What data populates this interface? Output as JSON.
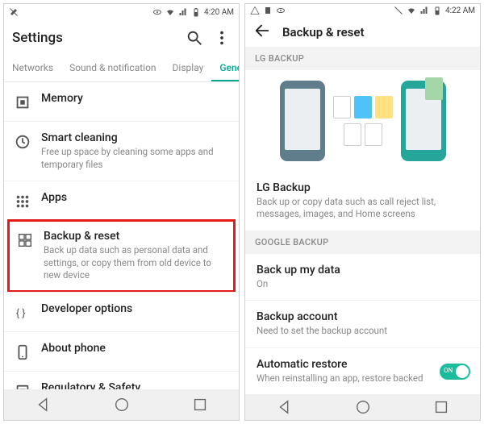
{
  "left": {
    "status": {
      "time": "4:20 AM"
    },
    "header": {
      "title": "Settings"
    },
    "tabs": [
      {
        "label": "Networks",
        "active": false
      },
      {
        "label": "Sound & notification",
        "active": false
      },
      {
        "label": "Display",
        "active": false
      },
      {
        "label": "General",
        "active": true
      }
    ],
    "items": [
      {
        "icon": "memory",
        "title": "Memory",
        "sub": ""
      },
      {
        "icon": "smart-cleaning",
        "title": "Smart cleaning",
        "sub": "Free up space by cleaning some apps and temporary files"
      },
      {
        "icon": "apps",
        "title": "Apps",
        "sub": ""
      },
      {
        "icon": "backup-reset",
        "title": "Backup & reset",
        "sub": "Back up data such as personal data and settings, or copy them from old device to new device",
        "highlight": true
      },
      {
        "icon": "developer",
        "title": "Developer options",
        "sub": ""
      },
      {
        "icon": "about-phone",
        "title": "About phone",
        "sub": ""
      },
      {
        "icon": "regulatory",
        "title": "Regulatory & Safety",
        "sub": ""
      }
    ]
  },
  "right": {
    "status": {
      "time": "4:22 AM"
    },
    "header": {
      "title": "Backup & reset"
    },
    "sections": {
      "lg": {
        "header": "LG BACKUP",
        "item": {
          "title": "LG Backup",
          "sub": "Back up or copy data such as call reject list, messages, images, and Home screens"
        }
      },
      "google": {
        "header": "GOOGLE BACKUP",
        "items": [
          {
            "title": "Back up my data",
            "sub": "On"
          },
          {
            "title": "Backup account",
            "sub": "Need to set the backup account"
          },
          {
            "title": "Automatic restore",
            "sub": "When reinstalling an app, restore backed",
            "toggle": "ON"
          }
        ]
      }
    }
  }
}
